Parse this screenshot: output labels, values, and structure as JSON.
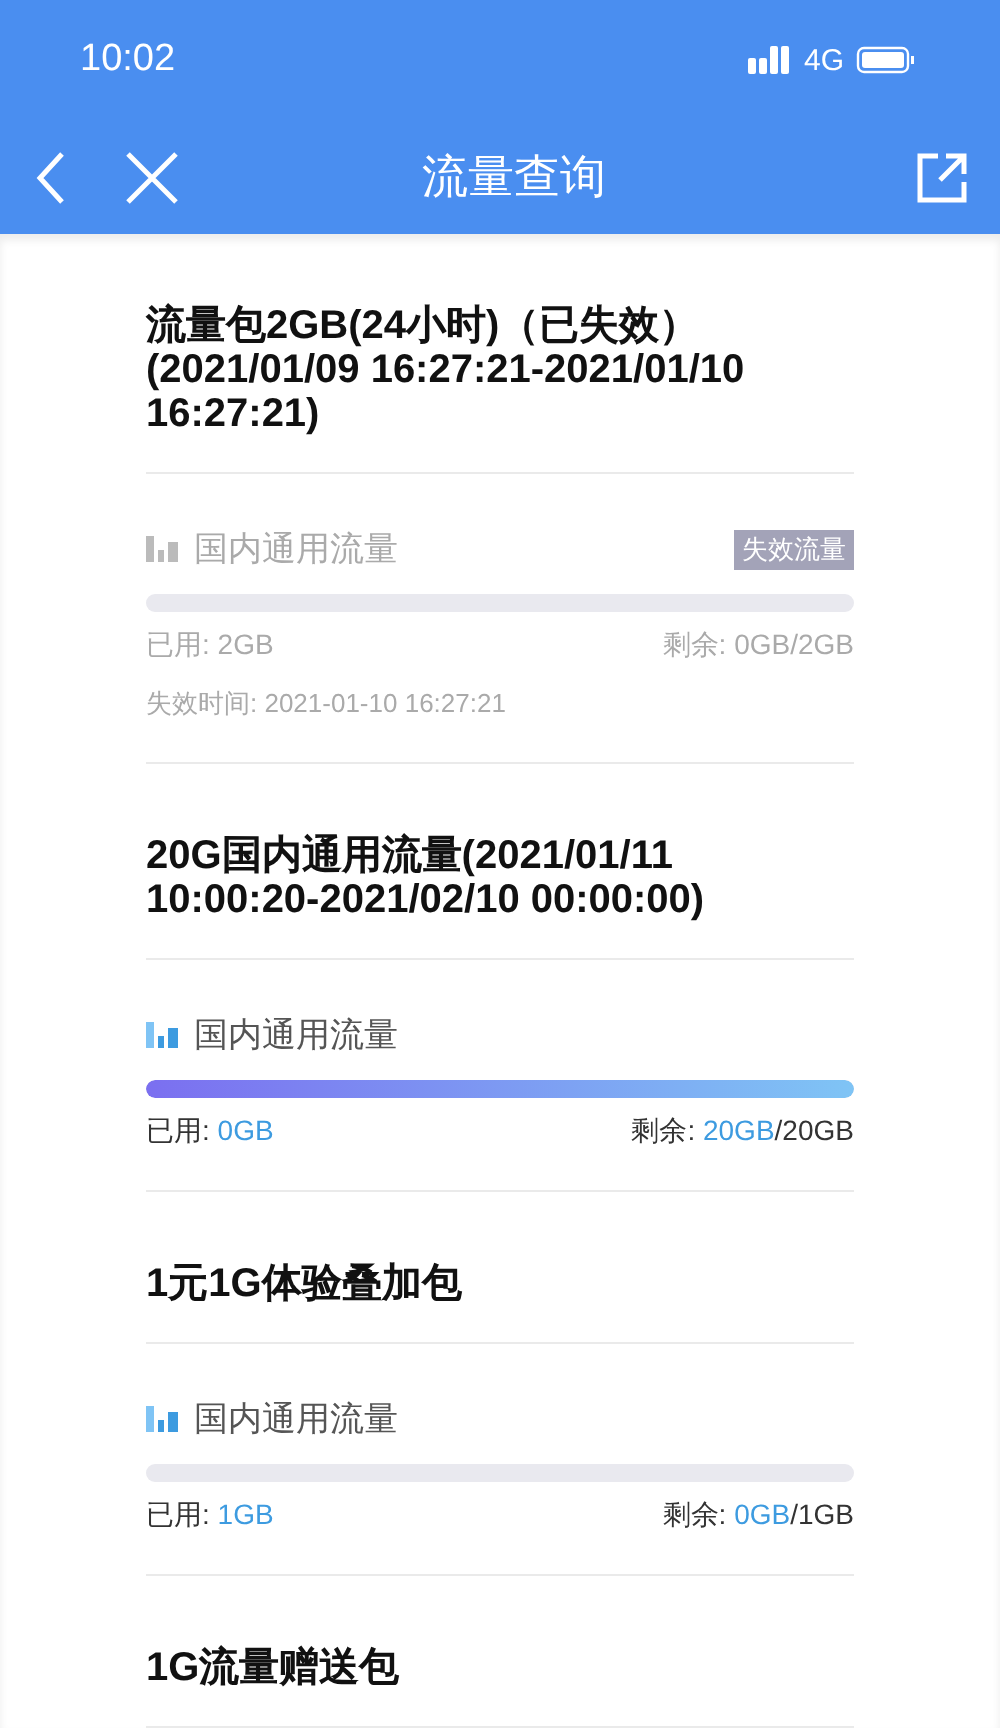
{
  "status_bar": {
    "time": "10:02",
    "network": "4G"
  },
  "nav": {
    "title": "流量查询"
  },
  "packages": [
    {
      "title": "流量包2GB(24小时)（已失效）(2021/01/09 16:27:21-2021/01/10 16:27:21)",
      "pools": [
        {
          "name": "国内通用流量",
          "expired": true,
          "badge": "失效流量",
          "used_label": "已用:",
          "used_value": "2GB",
          "remaining_label": "剩余:",
          "remaining_value": "0GB",
          "remaining_total": "/2GB",
          "expire_time": "失效时间: 2021-01-10 16:27:21"
        }
      ]
    },
    {
      "title": "20G国内通用流量(2021/01/11 10:00:20-2021/02/10 00:00:00)",
      "pools": [
        {
          "name": "国内通用流量",
          "expired": false,
          "level": 1,
          "used_label": "已用:",
          "used_value": "0GB",
          "remaining_label": "剩余:",
          "remaining_value": "20GB",
          "remaining_total": "/20GB"
        }
      ]
    },
    {
      "title": "1元1G体验叠加包",
      "pools": [
        {
          "name": "国内通用流量",
          "expired": false,
          "used_label": "已用:",
          "used_value": "1GB",
          "remaining_label": "剩余:",
          "remaining_value": "0GB",
          "remaining_total": "/1GB"
        }
      ]
    },
    {
      "title": "1G流量赠送包"
    }
  ]
}
